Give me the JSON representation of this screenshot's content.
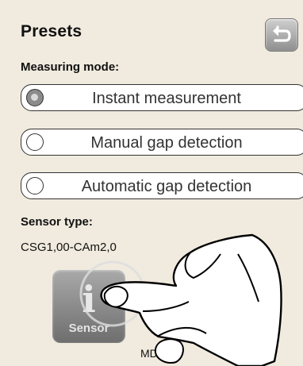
{
  "header": {
    "title": "Presets",
    "back_icon": "return-arrow-icon"
  },
  "measuring_mode": {
    "label": "Measuring mode:",
    "options": [
      {
        "label": "Instant measurement",
        "selected": true
      },
      {
        "label": "Manual gap detection",
        "selected": false
      },
      {
        "label": "Automatic gap detection",
        "selected": false
      }
    ]
  },
  "sensor": {
    "label": "Sensor type:",
    "value": "CSG1,00-CAm2,0",
    "button_label": "Sensor",
    "button_icon": "info-icon"
  },
  "footer_text": "MD",
  "colors": {
    "background": "#f1ebdf",
    "button_gray": "#8f8f8f"
  }
}
